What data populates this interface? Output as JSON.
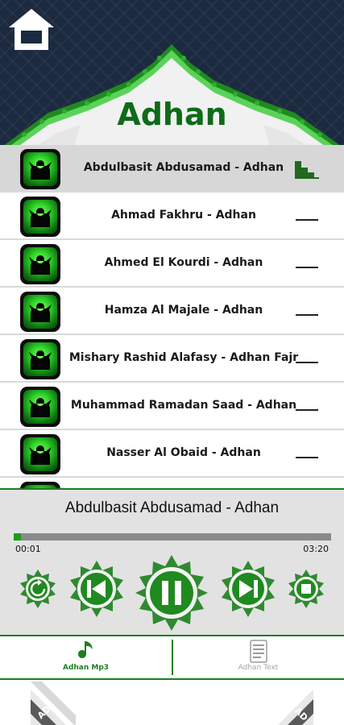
{
  "app": {
    "title": "Adhan"
  },
  "tracks": [
    {
      "title": "Abdulbasit Abdusamad - Adhan",
      "active": true
    },
    {
      "title": "Ahmad Fakhru - Adhan",
      "active": false
    },
    {
      "title": "Ahmed El Kourdi - Adhan",
      "active": false
    },
    {
      "title": "Hamza Al Majale - Adhan",
      "active": false
    },
    {
      "title": "Mishary Rashid Alafasy - Adhan Fajr",
      "active": false
    },
    {
      "title": "Muhammad Ramadan Saad - Adhan",
      "active": false
    },
    {
      "title": "Nasser Al Obaid - Adhan",
      "active": false
    }
  ],
  "player": {
    "now_playing": "Abdulbasit Abdusamad - Adhan",
    "current_time": "00:01",
    "total_time": "03:20",
    "progress": 0.005,
    "controls": [
      "repeat-icon",
      "previous-icon",
      "pause-icon",
      "next-icon",
      "stop-icon"
    ]
  },
  "tabs": {
    "mp3_label": "Adhan Mp3",
    "text_label": "Adhan Text"
  },
  "ads": {
    "left_label": "AD",
    "right_label": "AD"
  },
  "colors": {
    "accent": "#1f7d1f",
    "title_green": "#0e6b18",
    "header_bg": "#1c2a40",
    "active_row": "#d7d7d7",
    "player_bg": "#e2e2e2"
  }
}
